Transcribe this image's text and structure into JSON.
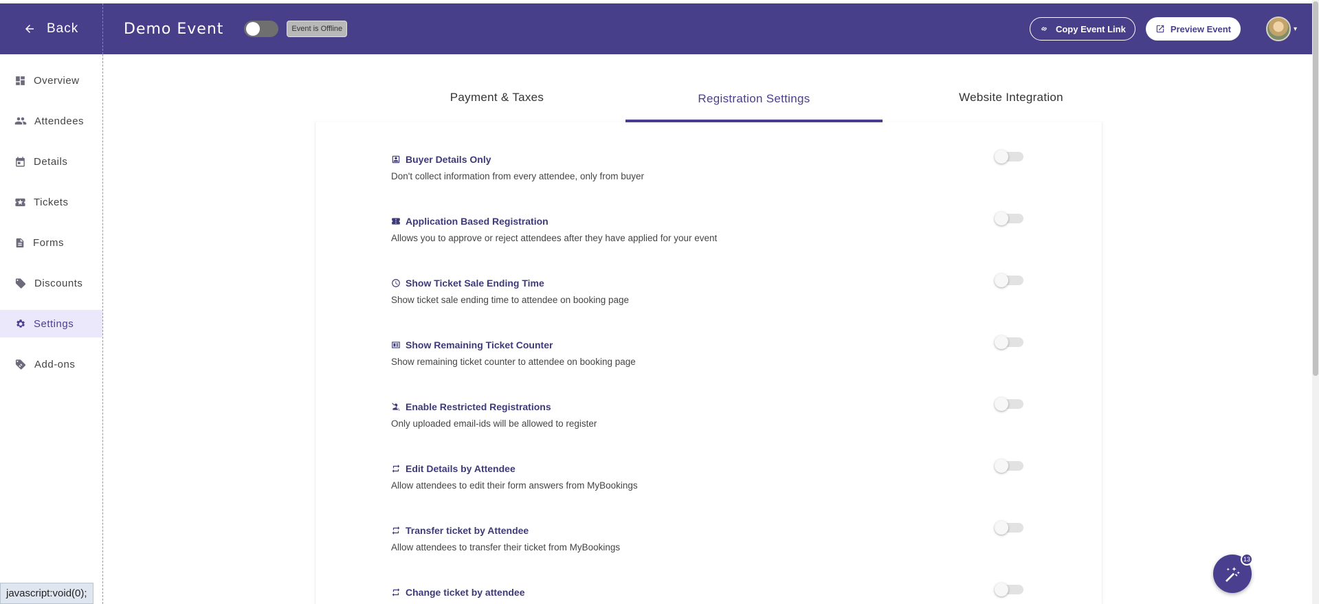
{
  "header": {
    "back_label": "Back",
    "event_title": "Demo Event",
    "offline_badge": "Event is Offline",
    "copy_link_label": "Copy Event Link",
    "preview_label": "Preview Event"
  },
  "sidebar": {
    "items": [
      {
        "label": "Overview",
        "icon": "dashboard-icon"
      },
      {
        "label": "Attendees",
        "icon": "people-icon"
      },
      {
        "label": "Details",
        "icon": "calendar-icon"
      },
      {
        "label": "Tickets",
        "icon": "ticket-star-icon"
      },
      {
        "label": "Forms",
        "icon": "form-icon"
      },
      {
        "label": "Discounts",
        "icon": "tag-icon"
      },
      {
        "label": "Settings",
        "icon": "gear-icon"
      },
      {
        "label": "Add-ons",
        "icon": "addon-tag-icon"
      }
    ],
    "active": "Settings"
  },
  "tabs": [
    {
      "label": "Payment & Taxes"
    },
    {
      "label": "Registration Settings"
    },
    {
      "label": "Website Integration"
    }
  ],
  "active_tab": "Registration Settings",
  "settings": [
    {
      "title": "Buyer Details Only",
      "desc": "Don't collect information from every attendee, only from buyer",
      "icon": "person-box-icon",
      "enabled": false
    },
    {
      "title": "Application Based Registration",
      "desc": "Allows you to approve or reject attendees after they have applied for your event",
      "icon": "ticket-icon",
      "enabled": false
    },
    {
      "title": "Show Ticket Sale Ending Time",
      "desc": "Show ticket sale ending time to attendee on booking page",
      "icon": "clock-icon",
      "enabled": false
    },
    {
      "title": "Show Remaining Ticket Counter",
      "desc": "Show remaining ticket counter to attendee on booking page",
      "icon": "counter-icon",
      "enabled": false
    },
    {
      "title": "Enable Restricted Registrations",
      "desc": "Only uploaded email-ids will be allowed to register",
      "icon": "restricted-person-icon",
      "enabled": false
    },
    {
      "title": "Edit Details by Attendee",
      "desc": "Allow attendees to edit their form answers from MyBookings",
      "icon": "repeat-icon",
      "enabled": false
    },
    {
      "title": "Transfer ticket by Attendee",
      "desc": "Allow attendees to transfer their ticket from MyBookings",
      "icon": "repeat-icon",
      "enabled": false
    },
    {
      "title": "Change ticket by attendee",
      "desc": "",
      "icon": "repeat-icon",
      "enabled": false
    }
  ],
  "status_tip": "javascript:void(0);",
  "fab_badge": "13",
  "colors": {
    "brand": "#483f8a",
    "active_nav_bg": "#ece8fb"
  }
}
